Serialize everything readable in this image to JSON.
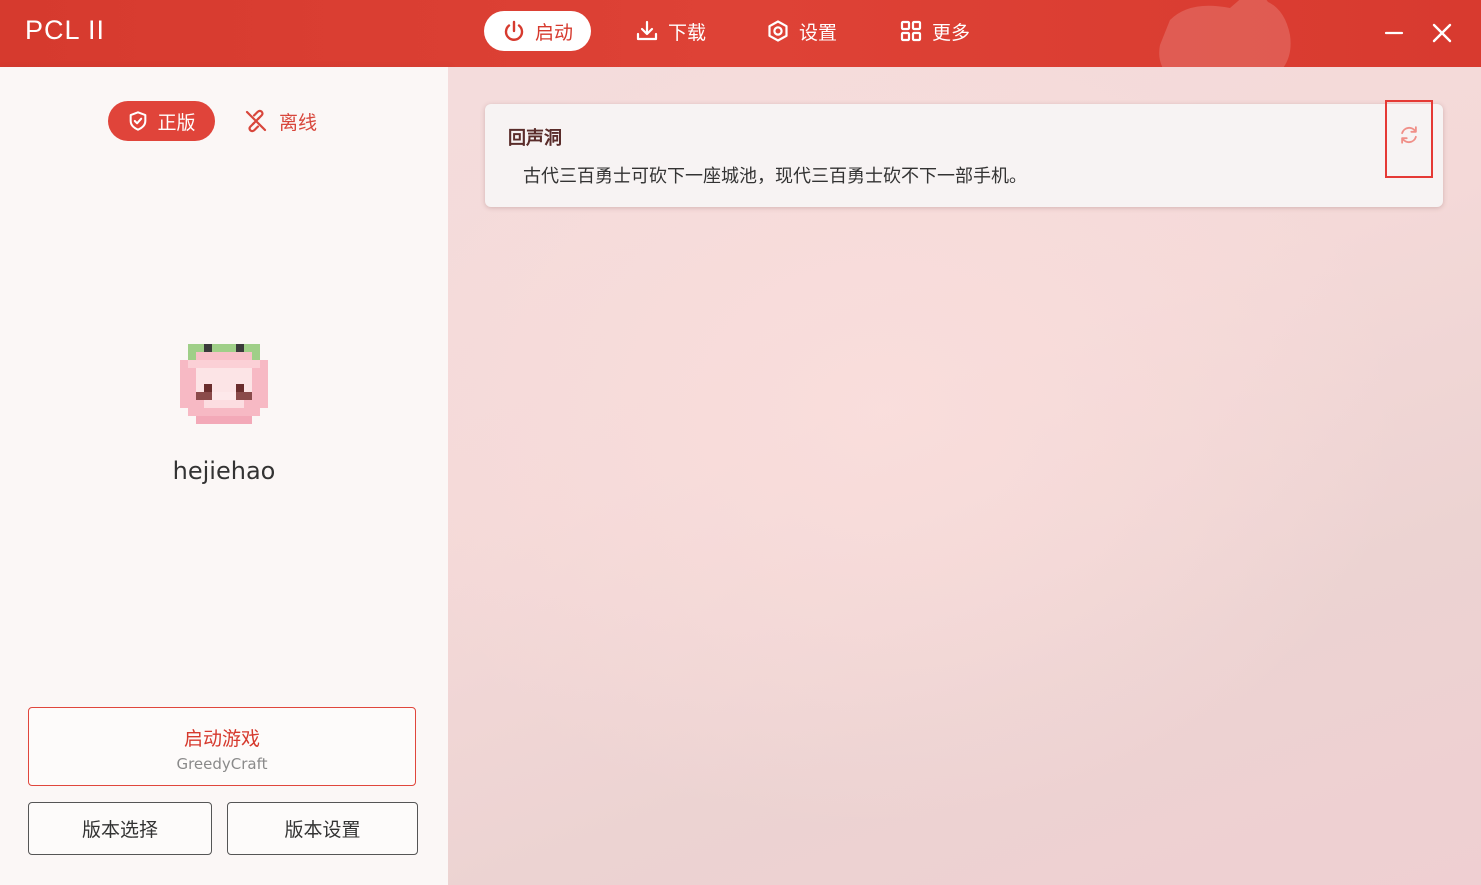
{
  "titlebar": {
    "app_title": "PCL II",
    "nav": [
      {
        "label": "启动",
        "icon": "power-icon",
        "active": true
      },
      {
        "label": "下载",
        "icon": "download-icon",
        "active": false
      },
      {
        "label": "设置",
        "icon": "settings-icon",
        "active": false
      },
      {
        "label": "更多",
        "icon": "grid-icon",
        "active": false
      }
    ],
    "controls": [
      "minimize-icon",
      "close-icon"
    ]
  },
  "left_panel": {
    "login_modes": [
      {
        "label": "正版",
        "icon": "shield-check-icon",
        "selected": true
      },
      {
        "label": "离线",
        "icon": "link-broken-icon",
        "selected": false
      }
    ],
    "username": "hejiehao",
    "launch_button": {
      "label": "启动游戏",
      "version": "GreedyCraft"
    },
    "version_select_label": "版本选择",
    "version_settings_label": "版本设置"
  },
  "main": {
    "card": {
      "title": "回声洞",
      "text": "古代三百勇士可砍下一座城池，现代三百勇士砍不下一部手机。",
      "refresh_icon": "refresh-icon"
    }
  },
  "colors": {
    "accent": "#d63a2e",
    "accent_light": "#e0443a",
    "highlight_box": "#e53935"
  }
}
